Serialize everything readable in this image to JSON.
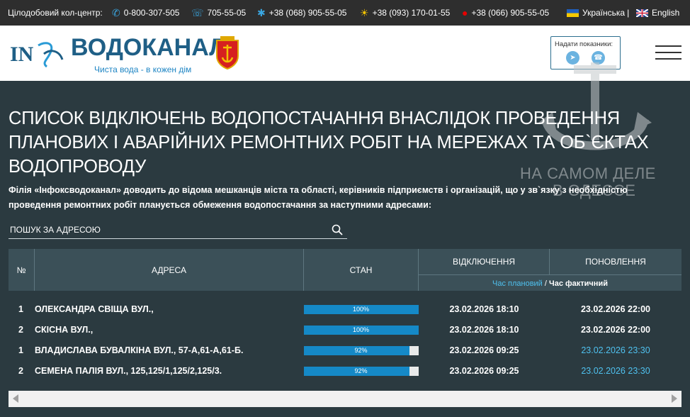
{
  "topbar": {
    "callcenter_label": "Цілодобовий кол-центр:",
    "phones": [
      {
        "icon": "phone-icon",
        "number": "0-800-307-505"
      },
      {
        "icon": "old-phone-icon",
        "number": "705-55-05"
      },
      {
        "icon": "kyivstar-star-icon",
        "number": "+38 (068) 905-55-05"
      },
      {
        "icon": "lifecell-icon",
        "number": "+38 (093) 170-01-55"
      },
      {
        "icon": "vodafone-icon",
        "number": "+38 (066) 905-55-05"
      }
    ],
    "languages": [
      {
        "icon": "ukraine-flag-icon",
        "label": "Українська"
      },
      {
        "icon": "uk-flag-icon",
        "label": "English"
      }
    ],
    "lang_separator": "|"
  },
  "header": {
    "logo_text": "ВОДОКАНАЛ",
    "slogan": "Чиста вода - в кожен дім",
    "readings_label": "Надати показники:",
    "readings_icons": [
      "telegram-icon",
      "viber-icon"
    ]
  },
  "main": {
    "title": "СПИСОК ВІДКЛЮЧЕНЬ ВОДОПОСТАЧАННЯ ВНАСЛІДОК ПРОВЕДЕННЯ ПЛАНОВИХ І АВАРІЙНИХ РЕМОНТНИХ РОБІТ НА МЕРЕЖАХ ТА ОБ`ЄКТАХ ВОДОПРОВОДУ",
    "intro": "Філія «Інфоксводоканал» доводить до відома мешканців міста та області, керівників підприємств і організацій, що у зв`язку з необхідністю проведення ремонтних робіт планується обмеження водопостачання за наступними адресами:",
    "search_placeholder": "ПОШУК ЗА АДРЕСОЮ"
  },
  "table": {
    "headers": {
      "num": "№",
      "address": "АДРЕСА",
      "state": "СТАН",
      "off": "ВІДКЛЮЧЕННЯ",
      "restore": "ПОНОВЛЕННЯ",
      "time_planned": "Час плановий",
      "time_sep": " / ",
      "time_actual": "Час фактичний"
    },
    "rows": [
      {
        "num": "1",
        "address": "ОЛЕКСАНДРА СВІЩА ВУЛ.,",
        "progress_label": "100%",
        "progress": 1.0,
        "off": "23.02.2026 18:10",
        "restore": "23.02.2026 22:00",
        "restore_planned": false
      },
      {
        "num": "2",
        "address": "СКІСНА ВУЛ.,",
        "progress_label": "100%",
        "progress": 1.0,
        "off": "23.02.2026 18:10",
        "restore": "23.02.2026 22:00",
        "restore_planned": false
      },
      {
        "num": "1",
        "address": "ВЛАДИСЛАВА БУВАЛКІНА ВУЛ., 57-А,61-А,61-Б.",
        "progress_label": "92%",
        "progress": 0.92,
        "off": "23.02.2026 09:25",
        "restore": "23.02.2026 23:30",
        "restore_planned": true
      },
      {
        "num": "2",
        "address": "СЕМЕНА ПАЛІЯ ВУЛ., 125,125/1,125/2,125/3.",
        "progress_label": "92%",
        "progress": 0.92,
        "off": "23.02.2026 09:25",
        "restore": "23.02.2026 23:30",
        "restore_planned": true
      }
    ]
  },
  "watermark": {
    "line1": "НА САМОМ ДЕЛЕ",
    "line2": "В ОДЕССЕ"
  },
  "colors": {
    "accent": "#1589c7",
    "planned_time": "#4fc1ef",
    "background": "#2b3a40",
    "table_header": "#3b5058"
  }
}
